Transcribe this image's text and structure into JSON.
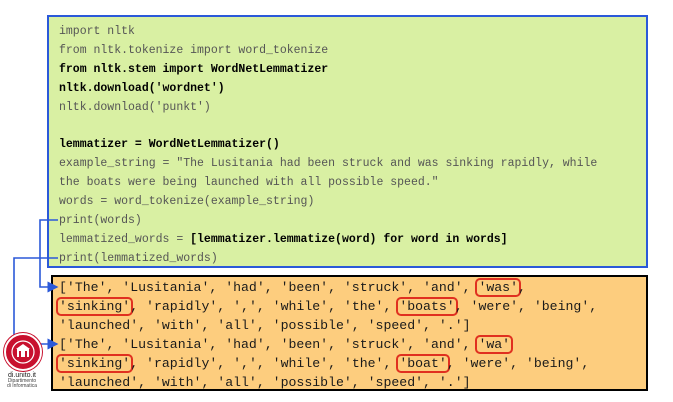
{
  "code": {
    "lines": [
      "import nltk",
      "from nltk.tokenize import word_tokenize",
      "from nltk.stem import WordNetLemmatizer",
      "nltk.download('wordnet')",
      "nltk.download('punkt')",
      "",
      "lemmatizer = WordNetLemmatizer()",
      "example_string = \"The Lusitania had been struck and was sinking rapidly, while",
      "the boats were being launched with all possible speed.\"",
      "words = word_tokenize(example_string)",
      "print(words)",
      "lemmatized_words = ",
      "[lemmatizer.lemmatize(word) for word in words]",
      "print(lemmatized_words)"
    ]
  },
  "output": {
    "words": {
      "l1_pre": "['The', 'Lusitania', 'had', 'been', 'struck', 'and', ",
      "l1_hl": "'was'",
      "l1_post": ",",
      "l2_hl1": "'sinking'",
      "l2_mid": ", 'rapidly', ',', 'while', 'the', ",
      "l2_hl2": "'boats'",
      "l2_post": ", 'were', 'being',",
      "l3": "'launched', 'with', 'all', 'possible', 'speed', '.']"
    },
    "lemmas": {
      "l1_pre": "['The', 'Lusitania', 'had', 'been', 'struck', 'and', ",
      "l1_hl": "'wa'",
      "l1_post": "",
      "l2_hl1": "'sinking'",
      "l2_mid": ", 'rapidly', ',', 'while', 'the', ",
      "l2_hl2": "'boat'",
      "l2_post": ", 'were', 'being',",
      "l3": "'launched', 'with', 'all', 'possible', 'speed', '.']"
    }
  },
  "logo": {
    "name": "di.unito.it",
    "sub1": "Dipartimento",
    "sub2": "di Informatica"
  },
  "colors": {
    "code_bg": "#d9f0a3",
    "code_border": "#2b59d9",
    "output_bg": "#fdcd7e",
    "highlight": "#e03020",
    "connector": "#2b59d9"
  }
}
